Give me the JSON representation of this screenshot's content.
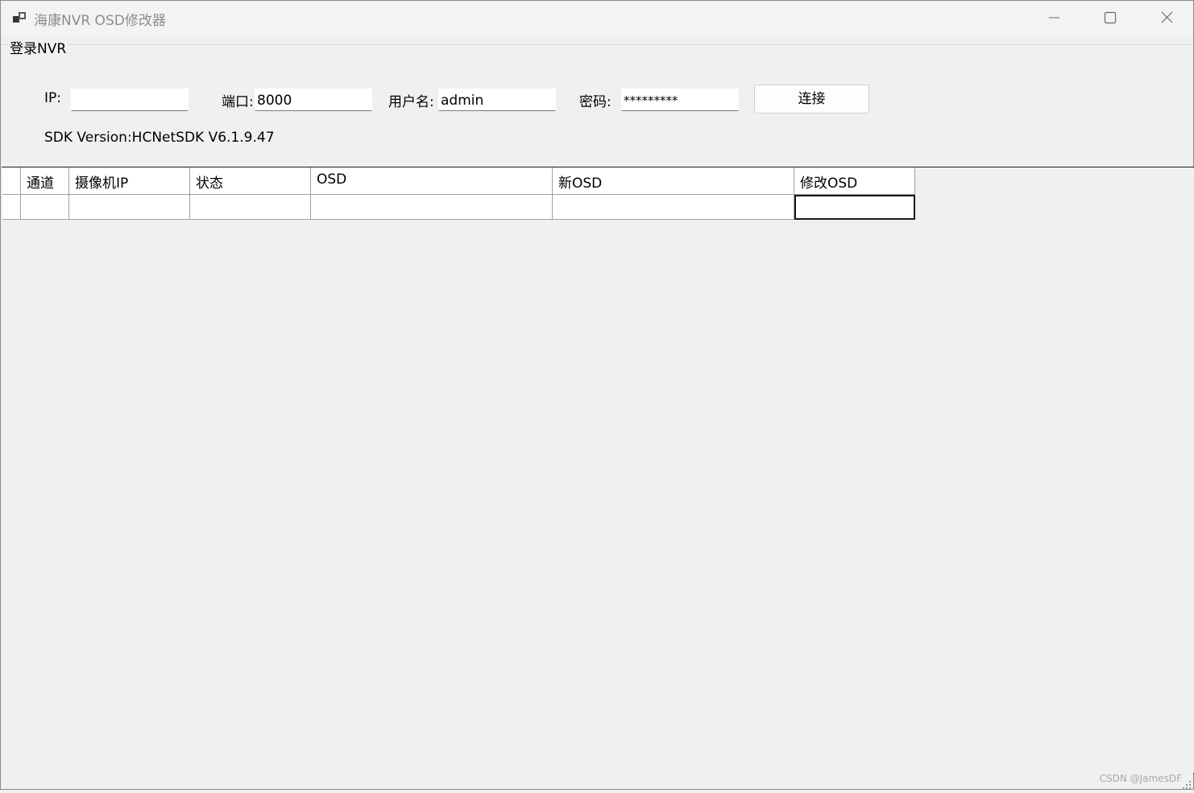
{
  "window": {
    "title": "海康NVR OSD修改器",
    "icon": "app-window-icon",
    "controls": [
      "minimize-icon",
      "maximize-icon",
      "close-icon"
    ]
  },
  "login_group": {
    "title": "登录NVR",
    "ip_label": "IP:",
    "ip_value": "",
    "port_label": "端口:",
    "port_value": "8000",
    "username_label": "用户名:",
    "username_value": "admin",
    "password_label": "密码:",
    "password_value": "*********",
    "connect_label": "连接",
    "sdk_version": "SDK Version:HCNetSDK V6.1.9.47"
  },
  "grid": {
    "columns": [
      "通道",
      "摄像机IP",
      "状态",
      "OSD",
      "新OSD",
      "修改OSD"
    ],
    "rows": [
      [
        "",
        "",
        "",
        "",
        "",
        ""
      ]
    ]
  },
  "footer": {
    "watermark": "CSDN @JamesDF"
  }
}
